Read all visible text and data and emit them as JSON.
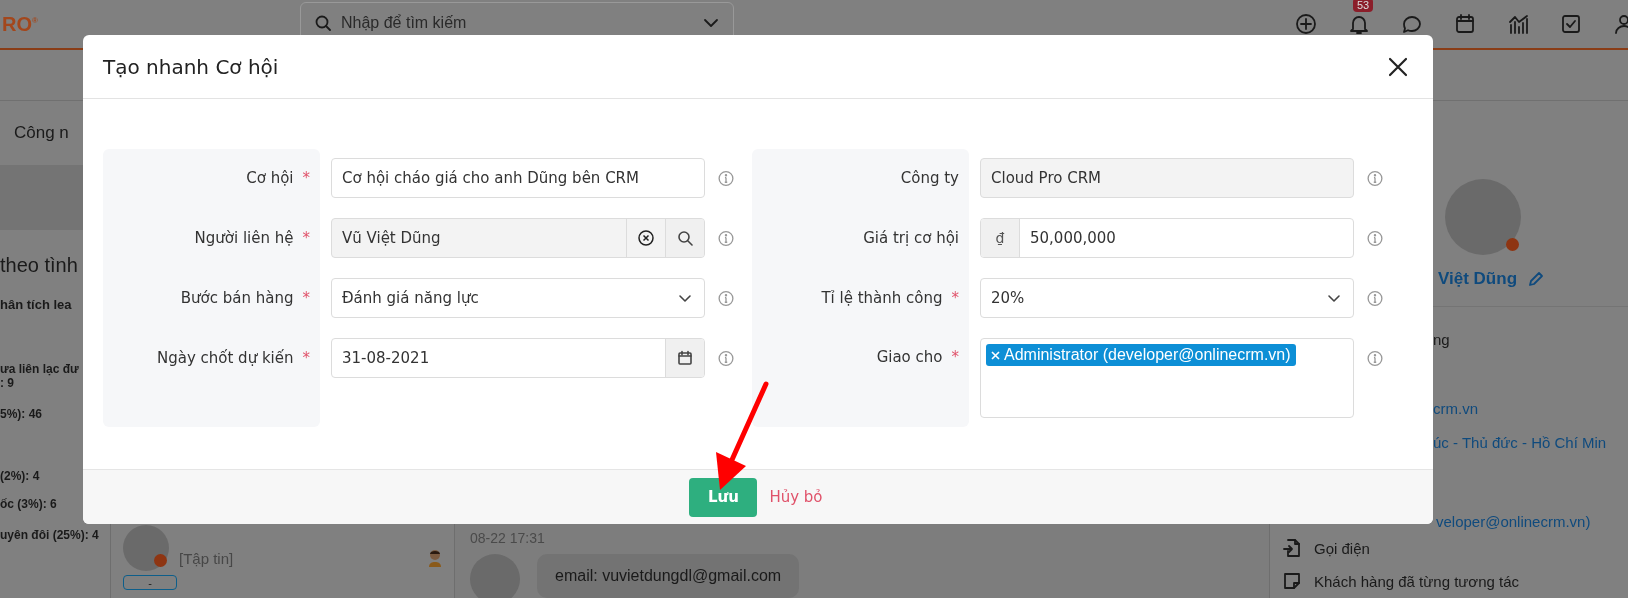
{
  "app": {
    "logo": "RO$^{®}$",
    "search": {
      "placeholder": "Nhập để tìm kiếm"
    },
    "notification_badge": "53",
    "tab_label": "Công n",
    "report": {
      "title": "theo tình",
      "subtitle": "hân tích lea",
      "legend": [
        "ưa liên lạc đư",
        ": 9",
        "5%): 46",
        "(2%): 4",
        "ốc (3%): 6",
        "uyên đôi (25%): 4"
      ]
    },
    "chat_list": {
      "preview": "[Tập tin]",
      "tag": "-"
    },
    "conversation": {
      "time": "08-22 17:31",
      "message": "email: vuvietdungdl@gmail.com"
    },
    "contact_panel": {
      "name": "Việt Dũng",
      "lines": [
        {
          "kind": "text",
          "text": "ng"
        },
        {
          "kind": "link",
          "text": "crm.vn"
        },
        {
          "kind": "link",
          "text": "úc - Thủ đức - Hồ Chí Min"
        },
        {
          "kind": "link",
          "text": "veloper@onlinecrm.vn)"
        },
        {
          "kind": "call",
          "text": "Gọi điện"
        },
        {
          "kind": "note",
          "text": "Khách hàng đã từng tương tác"
        }
      ]
    }
  },
  "modal": {
    "title": "Tạo nhanh Cơ hội",
    "left_fields": [
      {
        "kind": "text",
        "label": "Cơ hội",
        "required_mark": "*",
        "value": "Cơ hội cháo giá cho anh Dũng bên CRM"
      },
      {
        "kind": "lookup",
        "label": "Người liên hệ",
        "required_mark": "*",
        "value": "Vũ Việt Dũng"
      },
      {
        "kind": "select",
        "label": "Bước bán hàng",
        "required_mark": "*",
        "value": "Đánh giá năng lực"
      },
      {
        "kind": "date",
        "label": "Ngày chốt dự kiến",
        "required_mark": "*",
        "value": "31-08-2021"
      }
    ],
    "right_fields": [
      {
        "kind": "readonly",
        "label": "Công ty",
        "value": "Cloud Pro CRM"
      },
      {
        "kind": "currency",
        "label": "Giá trị cơ hội",
        "prefix": "₫",
        "value": "50,000,000"
      },
      {
        "kind": "select",
        "label": "Tỉ lệ thành công",
        "required_mark": "*",
        "value": "20%"
      },
      {
        "kind": "tags",
        "label": "Giao cho",
        "required_mark": "*",
        "tags": [
          "Administrator (developer@onlinecrm.vn)"
        ]
      }
    ],
    "buttons": [
      {
        "kind": "primary",
        "label": "Lưu"
      },
      {
        "kind": "link",
        "label": "Hủy bỏ"
      }
    ]
  }
}
